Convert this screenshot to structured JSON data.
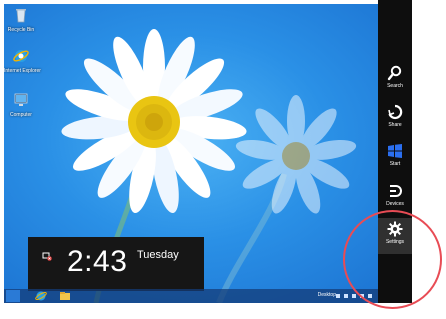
{
  "desktop": {
    "icons": [
      {
        "label": "Recycle Bin",
        "icon": "recycle-bin-icon"
      },
      {
        "label": "Internet Explorer",
        "icon": "internet-explorer-icon"
      },
      {
        "label": "Computer",
        "icon": "computer-icon"
      }
    ]
  },
  "lock_clock": {
    "time": "2:43",
    "day": "Tuesday"
  },
  "charms": [
    {
      "label": "Search",
      "icon": "search-icon"
    },
    {
      "label": "Share",
      "icon": "share-icon"
    },
    {
      "label": "Start",
      "icon": "windows-logo-icon"
    },
    {
      "label": "Devices",
      "icon": "devices-icon"
    },
    {
      "label": "Settings",
      "icon": "gear-icon"
    }
  ],
  "taskbar": {
    "toolbar_label": "Desktop",
    "pinned": [
      {
        "icon": "internet-explorer-icon"
      },
      {
        "icon": "file-explorer-icon"
      }
    ]
  },
  "colors": {
    "charms_bar": "#0e0e0e",
    "annotation": "#e84c55",
    "wallpaper": "#2a90e6"
  }
}
